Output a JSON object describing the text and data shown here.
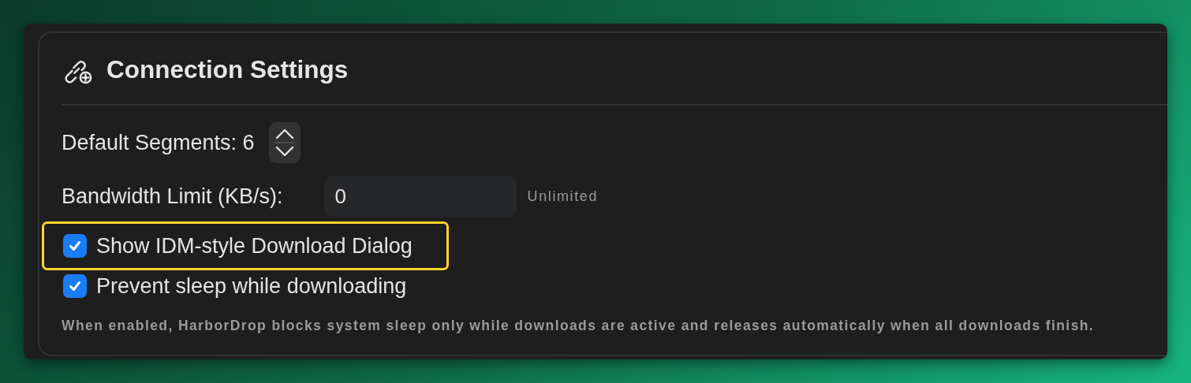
{
  "section": {
    "title": "Connection Settings"
  },
  "segments": {
    "label": "Default Segments: 6"
  },
  "bandwidth": {
    "label": "Bandwidth Limit (KB/s):",
    "value": "0",
    "hint": "Unlimited"
  },
  "options": [
    {
      "label": "Show IDM-style Download Dialog",
      "checked": true,
      "highlighted": true
    },
    {
      "label": "Prevent sleep while downloading",
      "checked": true,
      "highlighted": false
    }
  ],
  "note": "When enabled, HarborDrop blocks system sleep only while downloads are active and releases automatically when all downloads finish."
}
